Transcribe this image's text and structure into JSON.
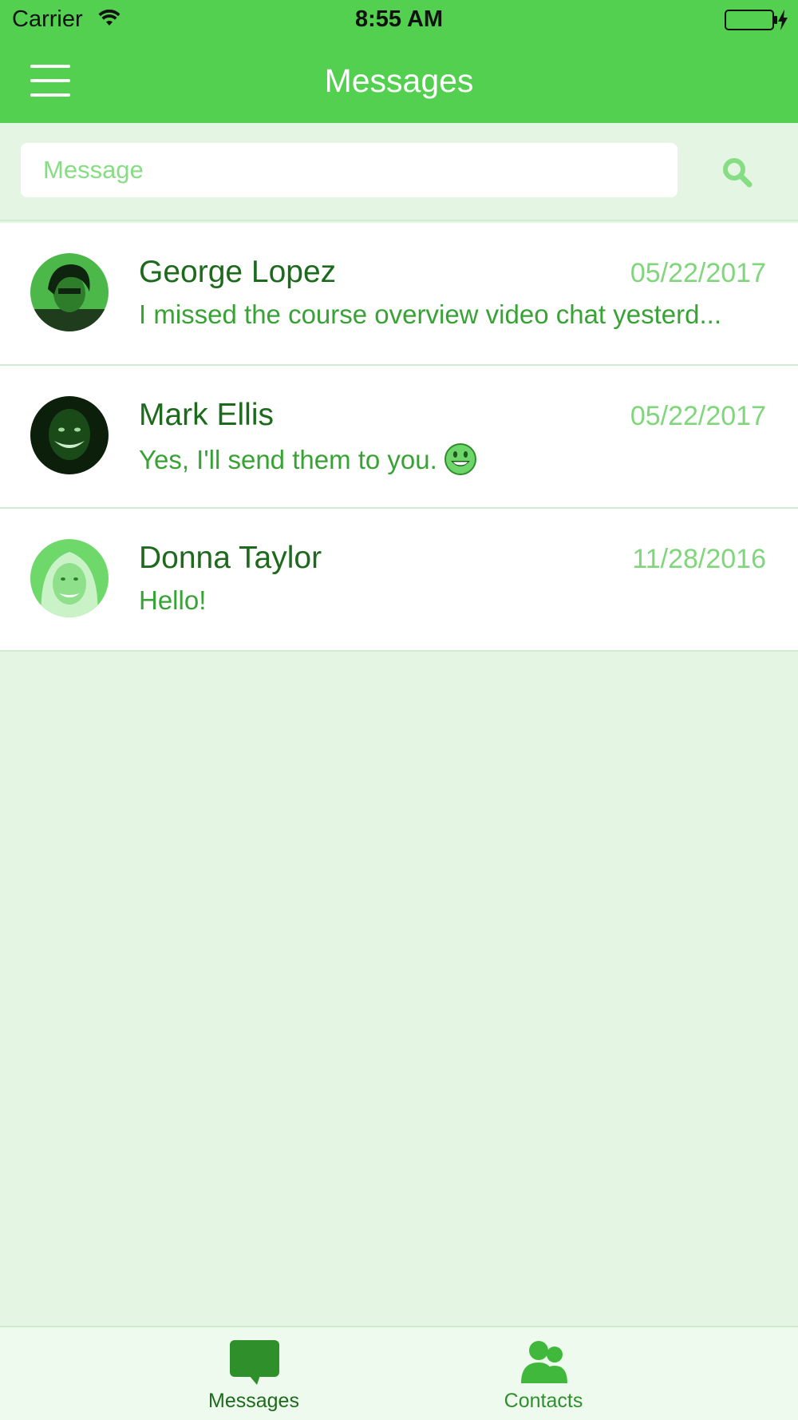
{
  "status_bar": {
    "carrier": "Carrier",
    "time": "8:55 AM"
  },
  "nav": {
    "title": "Messages",
    "menu_icon": "hamburger-menu-icon"
  },
  "search": {
    "placeholder": "Message",
    "icon": "search-icon"
  },
  "conversations": [
    {
      "name": "George Lopez",
      "date": "05/22/2017",
      "preview": "I missed the course overview video chat yesterd...",
      "emoji": ""
    },
    {
      "name": "Mark Ellis",
      "date": "05/22/2017",
      "preview": "Yes, I'll send them to you.",
      "emoji": "smiley-emoji"
    },
    {
      "name": "Donna Taylor",
      "date": "11/28/2016",
      "preview": "Hello!",
      "emoji": ""
    }
  ],
  "tab_bar": {
    "tabs": [
      {
        "label": "Messages",
        "icon": "chat-bubble-icon",
        "selected": true
      },
      {
        "label": "Contacts",
        "icon": "contacts-icon",
        "selected": false
      }
    ]
  },
  "colors": {
    "header": "#53d04f",
    "background": "#e5f5e3",
    "name_text": "#1d6a1c",
    "preview_text": "#38a335",
    "date_text": "#7fd67b",
    "tab_selected": "#2f8f2c"
  }
}
